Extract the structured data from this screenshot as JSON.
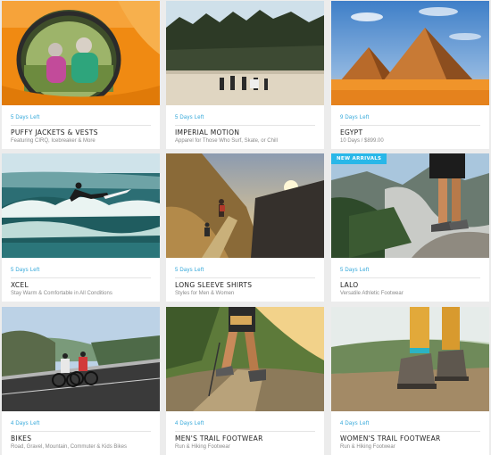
{
  "cards": [
    {
      "days": "5 Days Left",
      "title": "PUFFY JACKETS & VESTS",
      "subtitle": "Featuring CIRQ, Icebreaker & More",
      "badge": ""
    },
    {
      "days": "5 Days Left",
      "title": "IMPERIAL MOTION",
      "subtitle": "Apparel for Those Who Surf, Skate, or Chill",
      "badge": ""
    },
    {
      "days": "9 Days Left",
      "title": "EGYPT",
      "subtitle": "10 Days / $899.00",
      "badge": ""
    },
    {
      "days": "5 Days Left",
      "title": "XCEL",
      "subtitle": "Stay Warm & Comfortable in All Conditions",
      "badge": ""
    },
    {
      "days": "5 Days Left",
      "title": "LONG SLEEVE SHIRTS",
      "subtitle": "Styles for Men & Women",
      "badge": ""
    },
    {
      "days": "5 Days Left",
      "title": "LALO",
      "subtitle": "Versatile Athletic Footwear",
      "badge": "NEW ARRIVALS"
    },
    {
      "days": "4 Days Left",
      "title": "BIKES",
      "subtitle": "Road, Gravel, Mountain, Commuter & Kids Bikes",
      "badge": ""
    },
    {
      "days": "4 Days Left",
      "title": "MEN'S TRAIL FOOTWEAR",
      "subtitle": "Run & Hiking Footwear",
      "badge": ""
    },
    {
      "days": "4 Days Left",
      "title": "WOMEN'S TRAIL FOOTWEAR",
      "subtitle": "Run & Hiking Footwear",
      "badge": ""
    }
  ],
  "colors": {
    "accent": "#2fa6d9",
    "badge": "#29b7e8"
  },
  "images": [
    "tent-photo",
    "beach-people-photo",
    "pyramids-photo",
    "surfer-photo",
    "hiking-trail-photo",
    "hiker-on-rock-photo",
    "cyclists-photo",
    "trail-runner-photo",
    "hiking-boots-photo"
  ]
}
